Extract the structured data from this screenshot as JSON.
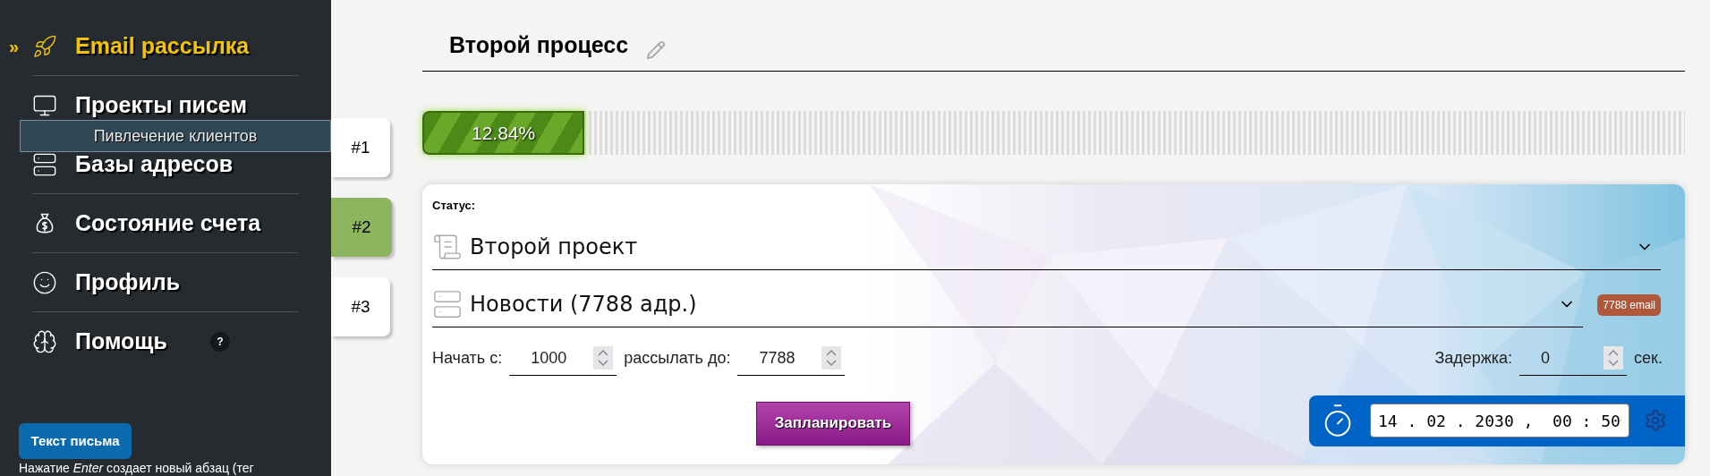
{
  "sidebar": {
    "marker": "»",
    "items": [
      {
        "label": "Email рассылка",
        "selected": true
      },
      {
        "label": "Проекты писем",
        "selected": false
      },
      {
        "label": "Базы адресов",
        "selected": false
      },
      {
        "label": "Состояние счета",
        "selected": false
      },
      {
        "label": "Профиль",
        "selected": false
      },
      {
        "label": "Помощь",
        "selected": false,
        "badge": "?"
      }
    ],
    "tooltip": "Пивлечение клиентов",
    "text_button": "Текст письма",
    "hint": "Нажатие *Enter* создает новый абзац (тег"
  },
  "process_tabs": [
    {
      "label": "#1",
      "selected": false
    },
    {
      "label": "#2",
      "selected": true
    },
    {
      "label": "#3",
      "selected": false
    }
  ],
  "title": "Второй процесс",
  "progress": {
    "level": 0.1284,
    "reading": "12.84%"
  },
  "form": {
    "status_label": "Статус:",
    "project_select": {
      "value": "Второй проект"
    },
    "list_select": {
      "value": "Новости (7788 адр.)",
      "badge": "7788 email"
    },
    "start": {
      "label": "Начать с:",
      "value": "1000"
    },
    "end": {
      "label": "рассылать до:",
      "value": "7788"
    },
    "delay": {
      "label": "Задержка:",
      "value": "0",
      "unit": "сек."
    },
    "schedule_button": "Запланировать",
    "datetime": "14 . 02 . 2030 ,  00 : 50"
  }
}
